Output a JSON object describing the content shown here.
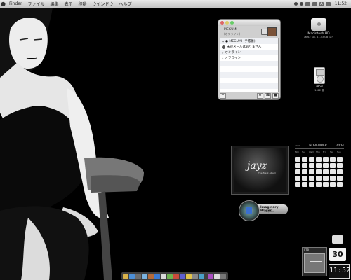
{
  "menubar": {
    "apple": "",
    "items": [
      "Finder",
      "ファイル",
      "編集",
      "表示",
      "移動",
      "ウインドウ",
      "ヘルプ"
    ],
    "input_badge": "A",
    "clock": "11:52"
  },
  "messenger": {
    "header": {
      "name": "MEGUMI",
      "status": "(オフライン)"
    },
    "rows": [
      {
        "text": "● MEGUMI (手帳着)"
      },
      {
        "text": "未読メールはありません"
      },
      {
        "text": "オンライン"
      },
      {
        "text": "オフライン"
      }
    ],
    "footer": {
      "add": "+",
      "text": "A"
    }
  },
  "desktop": {
    "hd": {
      "label": "Macintosh HD",
      "sub": "76.62 GB, 61.43 GB 空き"
    },
    "ipod": {
      "label": "iPod",
      "sub": "1682 曲"
    }
  },
  "calendar": {
    "year_small": "2004",
    "month": "NOVEMBER",
    "year": "2004",
    "days_of_week": [
      "Mon",
      "Tue",
      "Wed",
      "Thu",
      "Fri",
      "Sat",
      "Sun"
    ],
    "cells": 35
  },
  "album": {
    "logo": "jayz",
    "subtitle": "The Black Album"
  },
  "player": {
    "name": "Imaginary Player",
    "status": "Stopped"
  },
  "widgets": {
    "ftp_label": "FTP",
    "date": "30",
    "time": "11:52"
  },
  "dock_colors": [
    "#d9b24a",
    "#4d8fd6",
    "#6c6c6c",
    "#7ab2e0",
    "#b56b3a",
    "#3c7bd2",
    "#d8d8d8",
    "#6cb34f",
    "#c94a3a",
    "#5f5fd0",
    "#e2c44a",
    "#888888",
    "#4aa0c8",
    "#a94ec0",
    "#dddddd",
    "#777777"
  ]
}
